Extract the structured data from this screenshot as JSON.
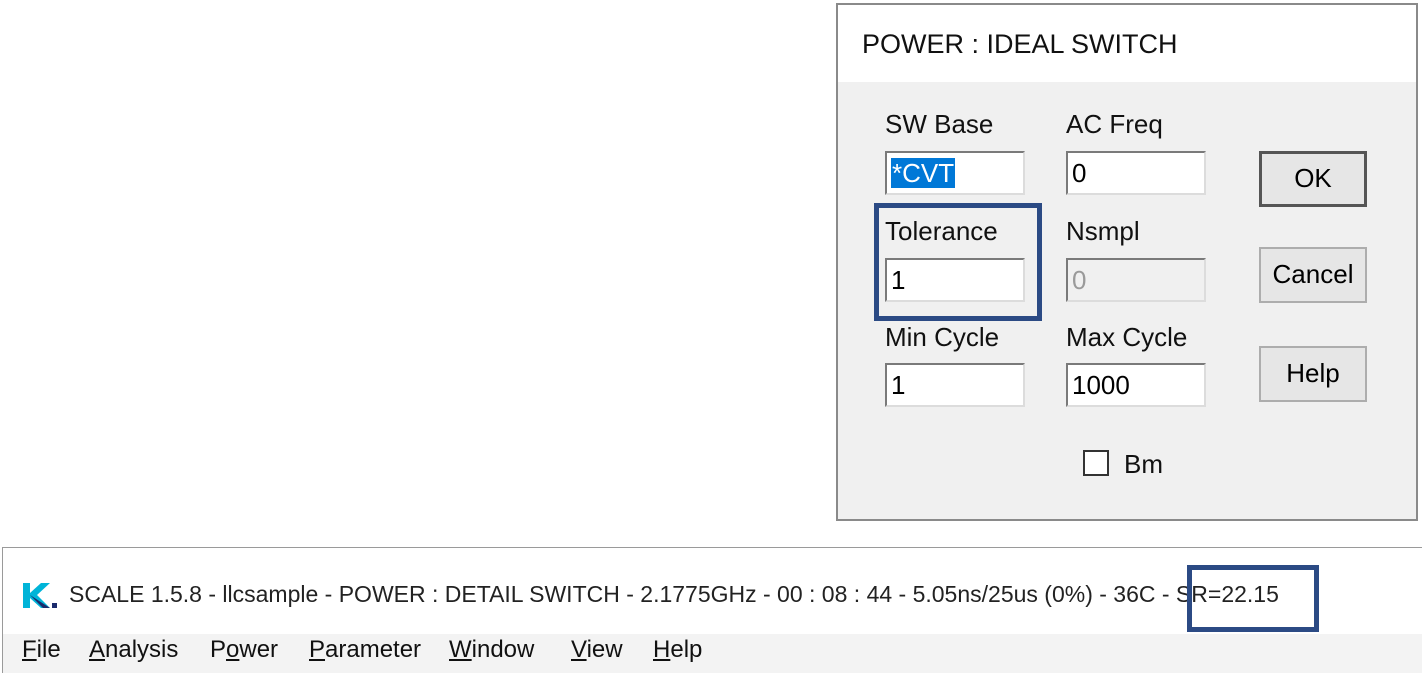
{
  "dialog": {
    "title": "POWER : IDEAL SWITCH",
    "fields": {
      "sw_base": {
        "label": "SW Base",
        "value": "*CVT"
      },
      "ac_freq": {
        "label": "AC Freq",
        "value": "0"
      },
      "tolerance": {
        "label": "Tolerance",
        "value": "1"
      },
      "nsmpl": {
        "label": "Nsmpl",
        "value": "0"
      },
      "min_cycle": {
        "label": "Min Cycle",
        "value": "1"
      },
      "max_cycle": {
        "label": "Max Cycle",
        "value": "1000"
      }
    },
    "buttons": {
      "ok": "OK",
      "cancel": "Cancel",
      "help": "Help"
    },
    "checkbox": {
      "label": "Bm",
      "checked": false
    }
  },
  "main_window": {
    "title": "SCALE 1.5.8 - llcsample - POWER : DETAIL SWITCH - 2.1775GHz - 00 : 08 : 44 - 5.05ns/25us (0%) - 36C - SR=22.15",
    "menu": [
      {
        "mnemonic": "F",
        "rest": "ile"
      },
      {
        "mnemonic": "A",
        "rest": "nalysis"
      },
      {
        "pre": "P",
        "mnemonic": "o",
        "rest": "wer"
      },
      {
        "mnemonic": "P",
        "rest": "arameter"
      },
      {
        "mnemonic": "W",
        "rest": "indow"
      },
      {
        "mnemonic": "V",
        "rest": "iew"
      },
      {
        "mnemonic": "H",
        "rest": "elp"
      }
    ]
  },
  "colors": {
    "highlight": "#2b4a84",
    "selection": "#0078d7",
    "logo_cyan": "#00b4d8",
    "logo_blue": "#1a2a6c"
  },
  "icons": {
    "app_logo": "k-logo-icon",
    "checkbox": "checkbox-icon"
  }
}
